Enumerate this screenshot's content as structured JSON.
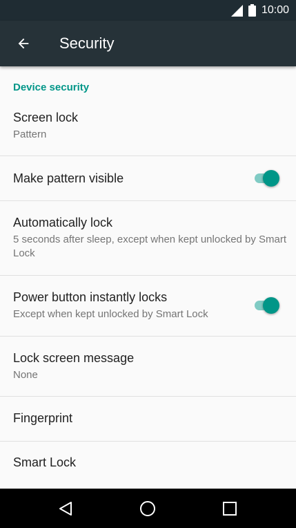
{
  "status_bar": {
    "time": "10:00",
    "icons": [
      "signal-icon",
      "battery-icon"
    ]
  },
  "app_bar": {
    "title": "Security",
    "back_icon": "arrow-left-icon"
  },
  "section": {
    "header": "Device security"
  },
  "items": [
    {
      "title": "Screen lock",
      "summary": "Pattern"
    },
    {
      "title": "Make pattern visible",
      "toggle": true
    },
    {
      "title": "Automatically lock",
      "summary": "5 seconds after sleep, except when kept unlocked by Smart Lock"
    },
    {
      "title": "Power button instantly locks",
      "summary": "Except when kept unlocked by Smart Lock",
      "toggle": true
    },
    {
      "title": "Lock screen message",
      "summary": "None"
    },
    {
      "title": "Fingerprint"
    },
    {
      "title": "Smart Lock"
    }
  ],
  "nav_bar": {
    "icons": [
      "back-triangle-icon",
      "home-circle-icon",
      "recents-square-icon"
    ]
  },
  "colors": {
    "accent": "#009688",
    "toolbar": "#263238",
    "status_bar": "#1f2c33",
    "toggle_track": "#80cbc4"
  }
}
